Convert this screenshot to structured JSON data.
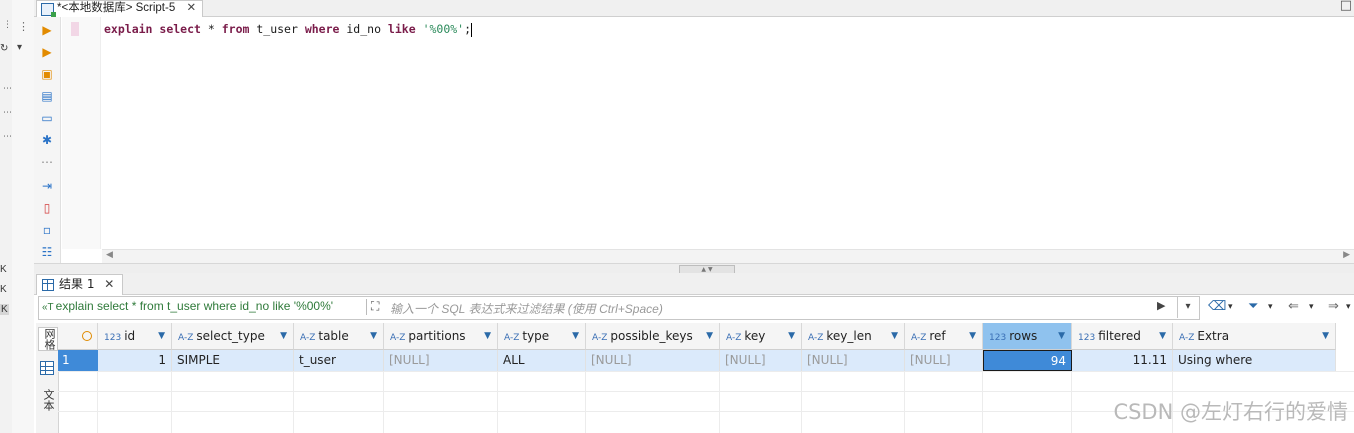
{
  "left_strip": {
    "labels": [
      "K",
      "K",
      "K"
    ]
  },
  "editor_tab": {
    "title": "*<本地数据库> Script-5",
    "close": "✕"
  },
  "window": {
    "restore": "□"
  },
  "editor": {
    "sql": [
      {
        "t": "explain",
        "c": "kw"
      },
      {
        "t": " "
      },
      {
        "t": "select",
        "c": "kw"
      },
      {
        "t": " * "
      },
      {
        "t": "from",
        "c": "kw"
      },
      {
        "t": " t_user "
      },
      {
        "t": "where",
        "c": "kw"
      },
      {
        "t": " id_no "
      },
      {
        "t": "like",
        "c": "kw"
      },
      {
        "t": " "
      },
      {
        "t": "'%00%'",
        "c": "str"
      },
      {
        "t": ";"
      }
    ]
  },
  "result_tab": {
    "label": "结果 1",
    "close": "✕"
  },
  "filter": {
    "query": "explain select * from t_user where id_no like '%00%'",
    "placeholder": "输入一个 SQL 表达式来过滤结果 (使用 Ctrl+Space)"
  },
  "side_tabs": {
    "grid": "网格",
    "text": "文本"
  },
  "grid": {
    "columns": [
      {
        "name": "id",
        "type": "123"
      },
      {
        "name": "select_type",
        "type": "A-Z"
      },
      {
        "name": "table",
        "type": "A-Z"
      },
      {
        "name": "partitions",
        "type": "A-Z"
      },
      {
        "name": "type",
        "type": "A-Z"
      },
      {
        "name": "possible_keys",
        "type": "A-Z"
      },
      {
        "name": "key",
        "type": "A-Z"
      },
      {
        "name": "key_len",
        "type": "A-Z"
      },
      {
        "name": "ref",
        "type": "A-Z"
      },
      {
        "name": "rows",
        "type": "123"
      },
      {
        "name": "filtered",
        "type": "123"
      },
      {
        "name": "Extra",
        "type": "A-Z"
      }
    ],
    "row_number": "1",
    "row": [
      "1",
      "SIMPLE",
      "t_user",
      "[NULL]",
      "ALL",
      "[NULL]",
      "[NULL]",
      "[NULL]",
      "[NULL]",
      "94",
      "11.11",
      "Using where"
    ]
  },
  "watermark": "CSDN @左灯右行的爱情"
}
